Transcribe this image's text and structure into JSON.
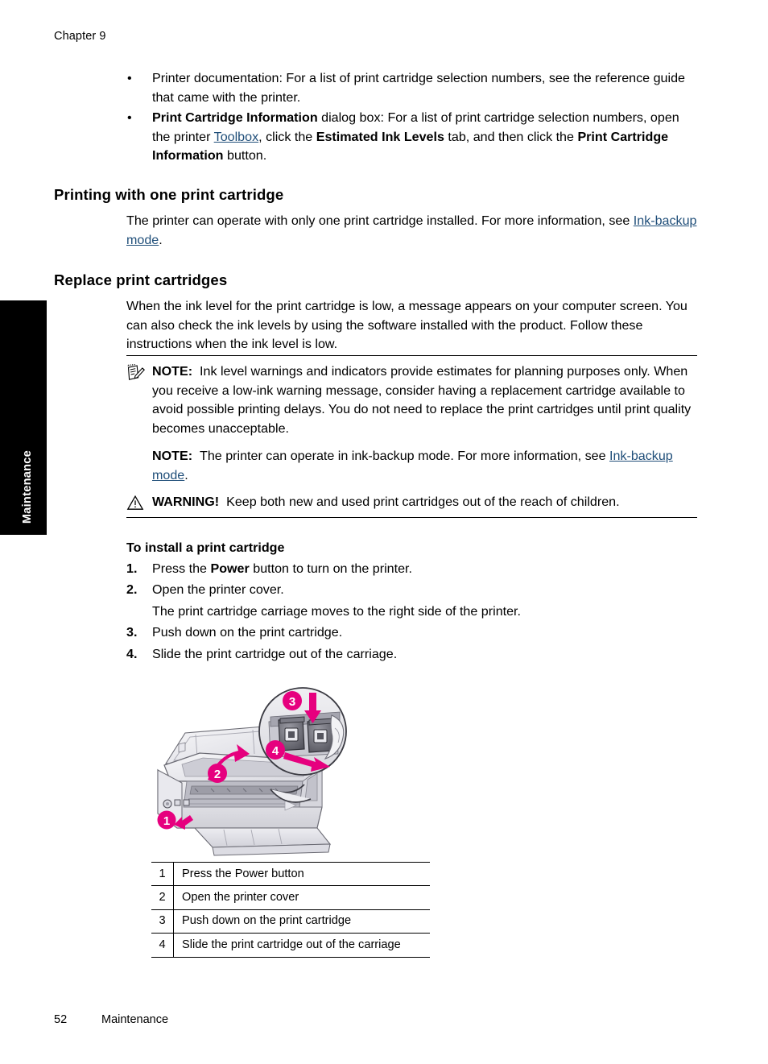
{
  "header": {
    "chapter": "Chapter 9"
  },
  "thumb_tab": {
    "label": "Maintenance",
    "background": "#000000",
    "text_color": "#ffffff"
  },
  "bullets": [
    {
      "marker": "•",
      "segments": [
        {
          "text": "Printer documentation: For a list of print cartridge selection numbers, see the reference guide that came with the printer.",
          "style": "normal"
        }
      ]
    },
    {
      "marker": "•",
      "segments": [
        {
          "text": "Print Cartridge Information",
          "style": "bold"
        },
        {
          "text": " dialog box: For a list of print cartridge selection numbers, open the printer ",
          "style": "normal"
        },
        {
          "text": "Toolbox",
          "style": "link"
        },
        {
          "text": ", click the ",
          "style": "normal"
        },
        {
          "text": "Estimated Ink Levels",
          "style": "bold"
        },
        {
          "text": " tab, and then click the ",
          "style": "normal"
        },
        {
          "text": "Print Cartridge Information",
          "style": "bold"
        },
        {
          "text": " button.",
          "style": "normal"
        }
      ]
    }
  ],
  "sections": [
    {
      "heading": "Printing with one print cartridge",
      "paragraph_segments": [
        {
          "text": "The printer can operate with only one print cartridge installed. For more information, see ",
          "style": "normal"
        },
        {
          "text": "Ink-backup mode",
          "style": "link"
        },
        {
          "text": ".",
          "style": "normal"
        }
      ]
    },
    {
      "heading": "Replace print cartridges",
      "paragraph_segments": [
        {
          "text": "When the ink level for the print cartridge is low, a message appears on your computer screen. You can also check the ink levels by using the software installed with the product. Follow these instructions when the ink level is low.",
          "style": "normal"
        }
      ]
    }
  ],
  "admonitions": [
    {
      "icon": "note-icon",
      "label": "NOTE:",
      "segments": [
        {
          "text": "Ink level warnings and indicators provide estimates for planning purposes only. When you receive a low-ink warning message, consider having a replacement cartridge available to avoid possible printing delays. You do not need to replace the print cartridges until print quality becomes unacceptable.",
          "style": "normal"
        }
      ]
    },
    {
      "icon": "",
      "label": "NOTE:",
      "segments": [
        {
          "text": "The printer can operate in ink-backup mode. For more information, see ",
          "style": "normal"
        },
        {
          "text": "Ink-backup mode",
          "style": "link"
        },
        {
          "text": ".",
          "style": "normal"
        }
      ]
    },
    {
      "icon": "warning-triangle-icon",
      "label": "WARNING!",
      "segments": [
        {
          "text": "Keep both new and used print cartridges out of the reach of children.",
          "style": "normal"
        }
      ]
    }
  ],
  "procedure": {
    "title": "To install a print cartridge",
    "steps": [
      {
        "number": "1.",
        "segments": [
          {
            "text": "Press the ",
            "style": "normal"
          },
          {
            "text": "Power",
            "style": "bold"
          },
          {
            "text": " button to turn on the printer.",
            "style": "normal"
          }
        ],
        "continuation": ""
      },
      {
        "number": "2.",
        "segments": [
          {
            "text": "Open the printer cover.",
            "style": "normal"
          }
        ],
        "continuation": "The print cartridge carriage moves to the right side of the printer."
      },
      {
        "number": "3.",
        "segments": [
          {
            "text": "Push down on the print cartridge.",
            "style": "normal"
          }
        ],
        "continuation": ""
      },
      {
        "number": "4.",
        "segments": [
          {
            "text": "Slide the print cartridge out of the carriage.",
            "style": "normal"
          }
        ],
        "continuation": ""
      }
    ]
  },
  "figure": {
    "name": "printer-cartridge-illustration",
    "callout_color": "#E6007E",
    "callouts": [
      "1",
      "2",
      "3",
      "4"
    ]
  },
  "legend_table": {
    "rows": [
      {
        "num": "1",
        "desc": "Press the Power button"
      },
      {
        "num": "2",
        "desc": "Open the printer cover"
      },
      {
        "num": "3",
        "desc": "Push down on the print cartridge"
      },
      {
        "num": "4",
        "desc": "Slide the print cartridge out of the carriage"
      }
    ]
  },
  "footer": {
    "page_number": "52",
    "label": "Maintenance"
  }
}
